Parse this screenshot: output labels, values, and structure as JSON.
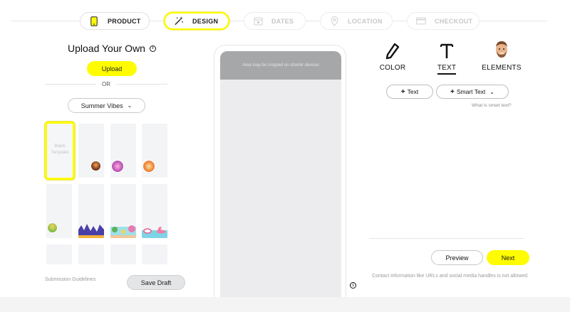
{
  "stepper": {
    "steps": [
      {
        "label": "PRODUCT",
        "icon": "phone-icon",
        "state": "done"
      },
      {
        "label": "DESIGN",
        "icon": "magic-wand-icon",
        "state": "active"
      },
      {
        "label": "DATES",
        "icon": "calendar-icon",
        "state": "disabled"
      },
      {
        "label": "LOCATION",
        "icon": "location-pin-icon",
        "state": "disabled"
      },
      {
        "label": "CHECKOUT",
        "icon": "credit-card-icon",
        "state": "disabled"
      }
    ]
  },
  "left": {
    "title": "Upload Your Own",
    "info_icon": "info-icon",
    "upload_label": "Upload",
    "or_label": "OR",
    "theme_selected": "Summer Vibes",
    "blank_template_label": "Blank Template",
    "submission_link": "Submission Guidelines",
    "save_draft_label": "Save Draft"
  },
  "preview": {
    "crop_note": "Area may be cropped on shorter devices"
  },
  "right": {
    "tabs": [
      {
        "label": "COLOR",
        "icon": "pen-icon"
      },
      {
        "label": "TEXT",
        "icon": "text-icon",
        "active": true
      },
      {
        "label": "ELEMENTS",
        "icon": "bitmoji-icon"
      }
    ],
    "add_text_label": "Text",
    "smart_text_label": "Smart Text",
    "smart_help": "What is smart text?",
    "preview_label": "Preview",
    "next_label": "Next",
    "contact_note": "Contact information like URLs and social media handles is not allowed."
  },
  "colors": {
    "accent": "#fffc00",
    "crop_overlay": "#a6a7a9",
    "template_bg": "#f3f4f6"
  }
}
